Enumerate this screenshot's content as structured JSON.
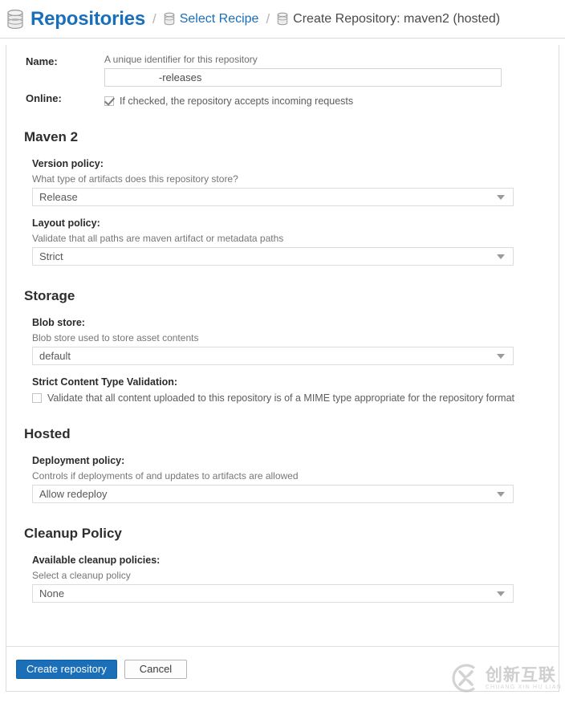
{
  "breadcrumb": {
    "root_label": "Repositories",
    "root_icon": "database-icon",
    "separator": "/",
    "link_label": "Select Recipe",
    "link_icon": "database-icon",
    "current_label": "Create Repository: maven2 (hosted)",
    "current_icon": "database-icon",
    "link_color": "#1a6fba"
  },
  "form": {
    "name": {
      "label": "Name:",
      "hint": "A unique identifier for this repository",
      "value": "        -releases",
      "placeholder": ""
    },
    "online": {
      "label": "Online:",
      "checkbox_label": "If checked, the repository accepts incoming requests",
      "checked": true
    }
  },
  "sections": [
    {
      "title": "Maven 2",
      "fields": [
        {
          "label": "Version policy:",
          "hint": "What type of artifacts does this repository store?",
          "type": "select",
          "value": "Release"
        },
        {
          "label": "Layout policy:",
          "hint": "Validate that all paths are maven artifact or metadata paths",
          "type": "select",
          "value": "Strict"
        }
      ]
    },
    {
      "title": "Storage",
      "fields": [
        {
          "label": "Blob store:",
          "hint": "Blob store used to store asset contents",
          "type": "select",
          "value": "default"
        },
        {
          "label": "Strict Content Type Validation:",
          "hint": "",
          "type": "checkbox",
          "checkbox_label": "Validate that all content uploaded to this repository is of a MIME type appropriate for the repository format",
          "checked": false
        }
      ]
    },
    {
      "title": "Hosted",
      "fields": [
        {
          "label": "Deployment policy:",
          "hint": "Controls if deployments of and updates to artifacts are allowed",
          "type": "select",
          "value": "Allow redeploy"
        }
      ]
    },
    {
      "title": "Cleanup Policy",
      "fields": [
        {
          "label": "Available cleanup policies:",
          "hint": "Select a cleanup policy",
          "type": "select",
          "value": "None"
        }
      ]
    }
  ],
  "footer": {
    "submit_label": "Create repository",
    "cancel_label": "Cancel",
    "submit_color": "#1b6fb8"
  },
  "watermark": {
    "logo_icon": "circled-x-logo",
    "chinese": "创新互联",
    "pinyin": "CHUANG XIN HU LIAN"
  }
}
